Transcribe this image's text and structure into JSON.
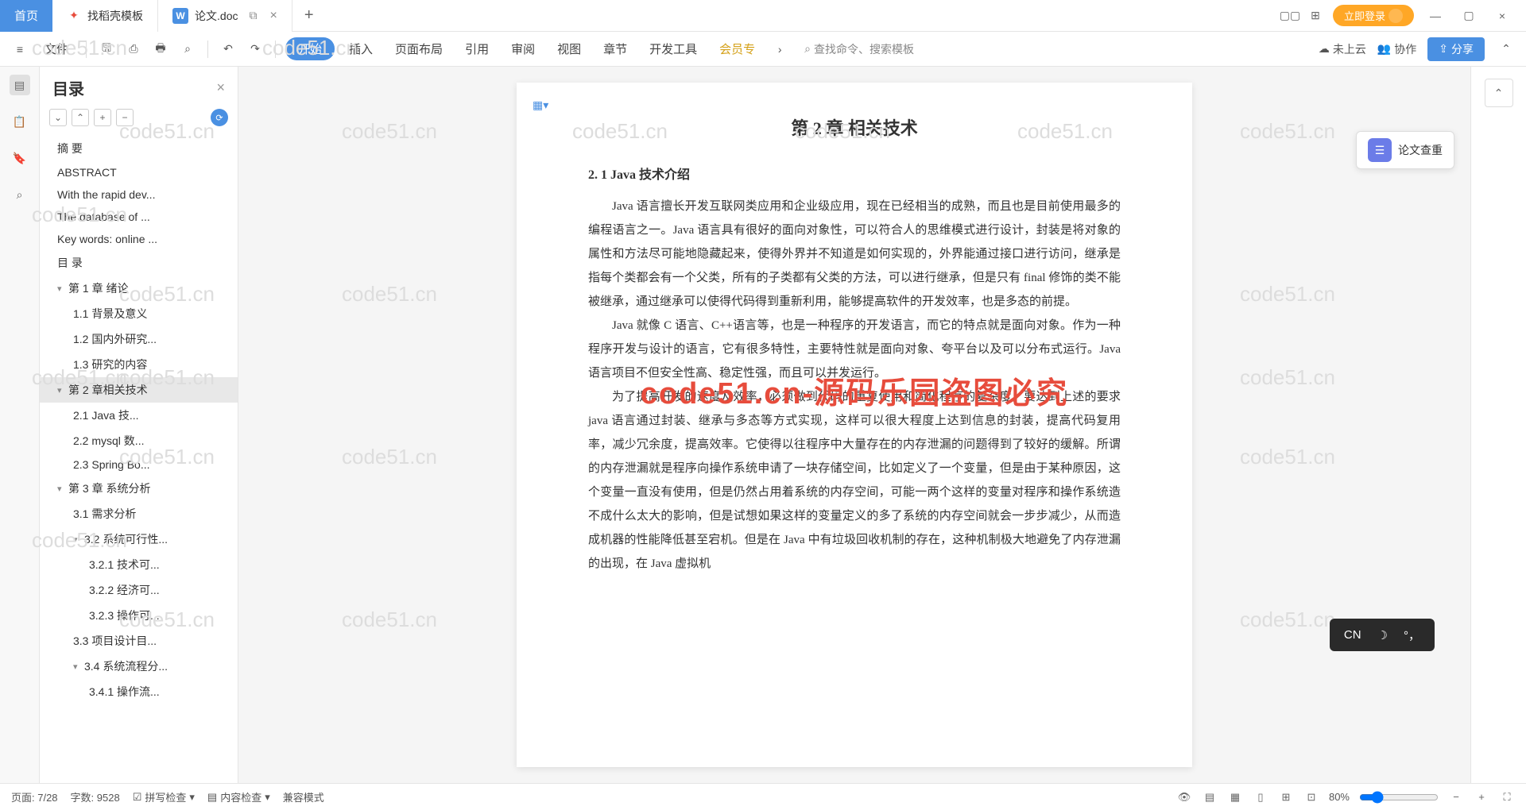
{
  "tabs": {
    "home": "首页",
    "template": "找稻壳模板",
    "doc": "论文.doc",
    "plus": "+"
  },
  "titlebar_right": {
    "login": "立即登录"
  },
  "ribbon": {
    "file": "文件",
    "start": "开始",
    "insert": "插入",
    "layout": "页面布局",
    "ref": "引用",
    "review": "审阅",
    "view": "视图",
    "chapter": "章节",
    "dev": "开发工具",
    "vip": "会员专",
    "search": "查找命令、搜索模板",
    "cloud": "未上云",
    "collab": "协作",
    "share": "分享"
  },
  "toc": {
    "title": "目录",
    "items": [
      {
        "text": "摘  要",
        "lvl": "l0"
      },
      {
        "text": "ABSTRACT",
        "lvl": "l0"
      },
      {
        "text": "With the rapid dev...",
        "lvl": "l0"
      },
      {
        "text": "The database of ...",
        "lvl": "l1"
      },
      {
        "text": "Key words: online ...",
        "lvl": "l0"
      },
      {
        "text": "目  录",
        "lvl": "l0"
      },
      {
        "text": "第 1 章  绪论",
        "lvl": "l1",
        "chev": "▾"
      },
      {
        "text": "1.1 背景及意义",
        "lvl": "l2"
      },
      {
        "text": "1.2  国内外研究...",
        "lvl": "l2"
      },
      {
        "text": "1.3  研究的内容",
        "lvl": "l2"
      },
      {
        "text": "第 2 章相关技术",
        "lvl": "l1",
        "chev": "▾",
        "active": true
      },
      {
        "text": "2.1    Java 技...",
        "lvl": "l2"
      },
      {
        "text": "2.2 mysql 数...",
        "lvl": "l2"
      },
      {
        "text": "2.3 Spring    Bo...",
        "lvl": "l2"
      },
      {
        "text": "第 3 章  系统分析",
        "lvl": "l1",
        "chev": "▾"
      },
      {
        "text": "3.1 需求分析",
        "lvl": "l2"
      },
      {
        "text": "3.2  系统可行性...",
        "lvl": "l2",
        "chev": "▾"
      },
      {
        "text": "3.2.1 技术可...",
        "lvl": "l3"
      },
      {
        "text": "3.2.2 经济可...",
        "lvl": "l3"
      },
      {
        "text": "3.2.3 操作可...",
        "lvl": "l3"
      },
      {
        "text": "3.3  项目设计目...",
        "lvl": "l2"
      },
      {
        "text": "3.4 系统流程分...",
        "lvl": "l2",
        "chev": "▾"
      },
      {
        "text": "3.4.1 操作流...",
        "lvl": "l3"
      }
    ]
  },
  "doc": {
    "chapter": "第 2 章  相关技术",
    "section": "2. 1   Java 技术介绍",
    "p1": "Java 语言擅长开发互联网类应用和企业级应用，现在已经相当的成熟，而且也是目前使用最多的编程语言之一。Java 语言具有很好的面向对象性，可以符合人的思维模式进行设计，封装是将对象的属性和方法尽可能地隐藏起来，使得外界并不知道是如何实现的，外界能通过接口进行访问，继承是指每个类都会有一个父类，所有的子类都有父类的方法，可以进行继承，但是只有 final 修饰的类不能被继承，通过继承可以使得代码得到重新利用，能够提高软件的开发效率，也是多态的前提。",
    "p2": "Java 就像 C 语言、C++语言等，也是一种程序的开发语言，而它的特点就是面向对象。作为一种程序开发与设计的语言，它有很多特性，主要特性就是面向对象、夸平台以及可以分布式运行。Java 语言项目不但安全性高、稳定性强，而且可以并发运行。",
    "p3": "为了提高开发的速度及效率，必须做到代码的重复使用和简化程序的复杂度，要达到上述的要求 java 语言通过封装、继承与多态等方式实现，这样可以很大程度上达到信息的封装，提高代码复用率，减少冗余度，提高效率。它使得以往程序中大量存在的内存泄漏的问题得到了较好的缓解。所谓的内存泄漏就是程序向操作系统申请了一块存储空间，比如定义了一个变量，但是由于某种原因，这个变量一直没有使用，但是仍然占用着系统的内存空间，可能一两个这样的变量对程序和操作系统造不成什么太大的影响，但是试想如果这样的变量定义的多了系统的内存空间就会一步步减少，从而造成机器的性能降低甚至宕机。但是在 Java 中有垃圾回收机制的存在，这种机制极大地避免了内存泄漏的出现，在 Java 虚拟机"
  },
  "float_tool": "论文查重",
  "watermark_red": "code51.cn-源码乐园盗图必究",
  "ime": {
    "lang": "CN",
    "moon": "☽",
    "mode": "°，"
  },
  "status": {
    "page": "页面: 7/28",
    "words": "字数: 9528",
    "spell": "拼写检查",
    "content": "内容检查",
    "compat": "兼容模式",
    "zoom": "80%"
  },
  "wm_text": "code51.cn"
}
